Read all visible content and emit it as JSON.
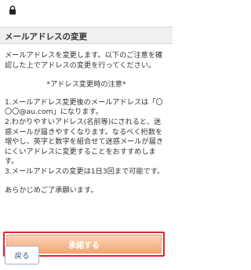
{
  "status_bar": {
    "lock_icon": "lock-icon"
  },
  "header": {
    "title": "メールアドレスの変更"
  },
  "content": {
    "intro": "メールアドレスを変更します。以下のご注意を確認した上でアドレスの変更を行ってください。",
    "notice_title": "*アドレス変更時の注意*",
    "notes": [
      "1.メールアドレス変更後のメールアドレスは「〇〇〇@au.com」になります。",
      "2.わかりやすいアドレス(名前等)にされると、迷惑メールが届きやすくなります。なるべく桁数を増やし、英字と数字を組合せて迷惑メールが届きにくいアドレスに変更することをおすすめします。",
      "3.メールアドレスの変更は1日3回まで可能です。"
    ],
    "closing": "あらかじめご了承願います。"
  },
  "buttons": {
    "confirm_label": "承諾する",
    "back_label": "戻る"
  },
  "colors": {
    "accent_border": "#e4252d",
    "confirm_gradient_top": "#fbd7b8",
    "confirm_gradient_bottom": "#f4a572",
    "header_bg": "#f0f0f0"
  }
}
